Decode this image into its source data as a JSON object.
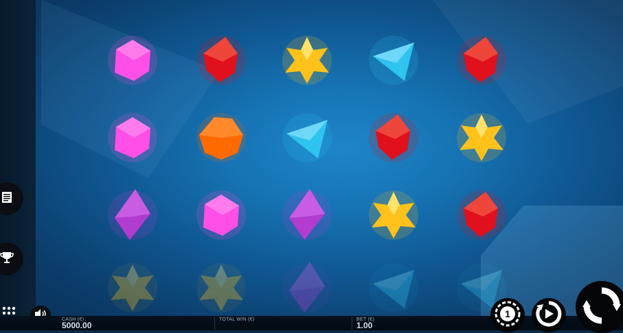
{
  "reels": [
    [
      "pink",
      "pink",
      "purple",
      "star"
    ],
    [
      "red",
      "orange",
      "pink",
      "star"
    ],
    [
      "star",
      "blue",
      "purple",
      "purple"
    ],
    [
      "blue",
      "red",
      "star",
      "blue"
    ],
    [
      "red",
      "star",
      "red",
      "blue"
    ]
  ],
  "meters": {
    "cash_label": "CASH (€)",
    "cash_value": "5000.00",
    "total_win_label": "TOTAL WIN (€)",
    "total_win_value": "",
    "bet_label": "BET (€)",
    "bet_value": "1.00"
  },
  "icons": {
    "paytable": "paytable-icon",
    "trophy": "trophy-icon",
    "menu": "grid-menu-icon",
    "sound": "speaker-icon",
    "coin": "coin-bet-icon",
    "autoplay": "autoplay-icon",
    "spin": "spin-icon"
  },
  "colors": {
    "pink": "#ff4fe6",
    "red": "#e0101c",
    "star": "#ffc21a",
    "blue": "#2fc4f0",
    "orange": "#ff6a00",
    "purple": "#b23cd0"
  }
}
